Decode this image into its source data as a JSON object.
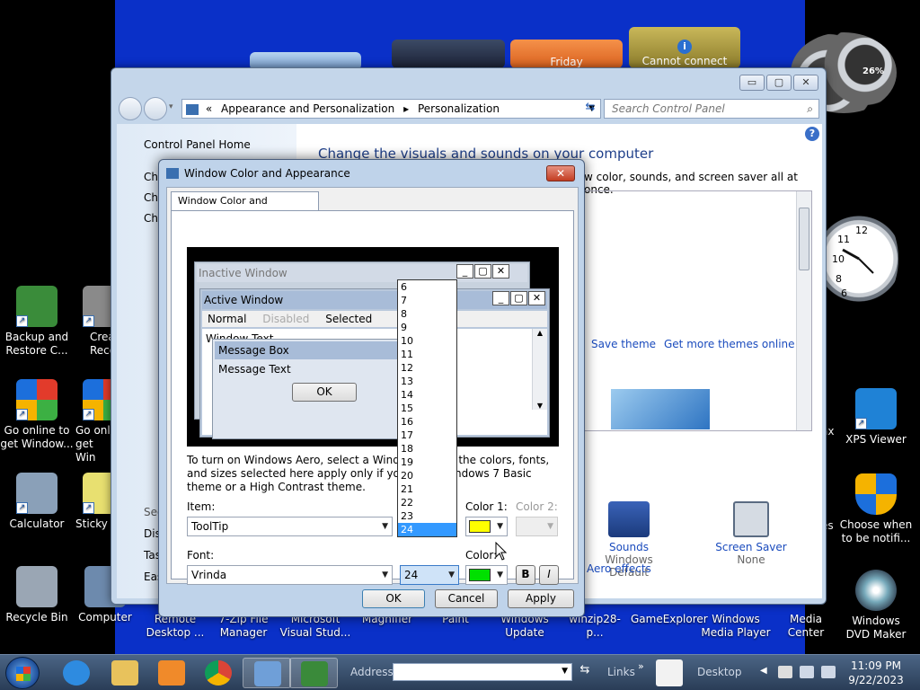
{
  "desktop": {
    "icons_left": [
      {
        "label": "Backup and Restore C...",
        "color": "#3a8c3a"
      },
      {
        "label": "Crea Recover",
        "color": "#8a8a8a"
      },
      {
        "label": "Go online to get Window...",
        "color": "#d9a520"
      },
      {
        "label": "Go onli get Win",
        "color": "#d9a520"
      },
      {
        "label": "Calculator",
        "color": "#8aa0b8"
      },
      {
        "label": "Sticky N",
        "color": "#e8e070"
      },
      {
        "label": "Recycle Bin",
        "color": "#9aa6b4"
      },
      {
        "label": "Computer",
        "color": "#6d8aad"
      }
    ],
    "icons_bottom": [
      "Remote Desktop ...",
      "7-Zip File Manager",
      "Microsoft Visual Stud...",
      "Magnifier",
      "Paint",
      "Windows Update",
      "winzip28-p...",
      "GameExplorer",
      "Windows Media Player",
      "Media Center"
    ],
    "icons_right": [
      {
        "label": "XPS Viewer"
      },
      {
        "label": "Choose when to be notifi..."
      },
      {
        "label": "Windows DVD Maker"
      }
    ],
    "partial_right_labels": [
      "ax",
      "es"
    ],
    "gadgets": {
      "calendar_label": "Friday",
      "weather_label": "Cannot connect",
      "cpu_meter": "26%"
    }
  },
  "control_panel": {
    "breadcrumb_prefix": "«",
    "breadcrumb": [
      "Appearance and Personalization",
      "Personalization"
    ],
    "search_placeholder": "Search Control Panel",
    "left_links": [
      "Control Panel Home",
      "Ch",
      "Ch",
      "Ch"
    ],
    "see_also": "See",
    "see_also_links": [
      "Disp",
      "Tas",
      "Eas"
    ],
    "heading": "Change the visuals and sounds on your computer",
    "subtext": "w color, sounds, and screen saver all at once.",
    "theme_links": {
      "save": "Save theme",
      "more": "Get more themes online"
    },
    "sounds": {
      "title": "Sounds",
      "value": "Windows Default"
    },
    "screensaver": {
      "title": "Screen Saver",
      "value": "None"
    },
    "aero_effects": "Aero effects"
  },
  "dialog": {
    "title": "Window Color and Appearance",
    "close": "✕",
    "tab": "Window Color and Appearance",
    "preview": {
      "inactive_title": "Inactive Window",
      "active_title": "Active Window",
      "menu_normal": "Normal",
      "menu_disabled": "Disabled",
      "menu_selected": "Selected",
      "window_text": "Window Text",
      "msgbox_title": "Message Box",
      "msgbox_text": "Message Text",
      "ok": "OK"
    },
    "description": "To turn on Windows Aero, select a Windows me of the colors, fonts, and sizes selected here apply only if yo ed the Windows 7 Basic theme or a High Contrast theme.",
    "item_label": "Item:",
    "item_value": "ToolTip",
    "color1_label": "Color 1:",
    "color2_label": "Color 2:",
    "color1": "#ffff00",
    "font_label": "Font:",
    "font_value": "Vrinda",
    "size_value": "24",
    "color_label": "Color:",
    "font_color": "#00e000",
    "bold_label": "B",
    "italic_label": "I",
    "size_options": [
      "6",
      "7",
      "8",
      "9",
      "10",
      "11",
      "12",
      "13",
      "14",
      "15",
      "16",
      "17",
      "18",
      "19",
      "20",
      "21",
      "22",
      "23",
      "24"
    ],
    "selected_size": "24",
    "ok": "OK",
    "cancel": "Cancel",
    "apply": "Apply"
  },
  "taskbar": {
    "address_label": "Address",
    "links_label": "Links",
    "desktop_label": "Desktop",
    "time": "11:09 PM",
    "date": "9/22/2023"
  }
}
